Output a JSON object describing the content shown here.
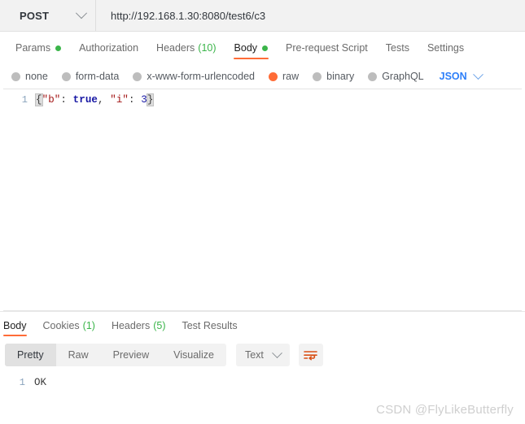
{
  "request": {
    "method": "POST",
    "method_icon": "chevron-down-icon",
    "url": "http://192.168.1.30:8080/test6/c3",
    "url_placeholder": "Enter request URL",
    "tabs": [
      {
        "label": "Params",
        "badge": "",
        "dot": true,
        "active": false
      },
      {
        "label": "Authorization",
        "badge": "",
        "dot": false,
        "active": false
      },
      {
        "label": "Headers",
        "badge": "(10)",
        "dot": false,
        "active": false
      },
      {
        "label": "Body",
        "badge": "",
        "dot": true,
        "active": true
      },
      {
        "label": "Pre-request Script",
        "badge": "",
        "dot": false,
        "active": false
      },
      {
        "label": "Tests",
        "badge": "",
        "dot": false,
        "active": false
      },
      {
        "label": "Settings",
        "badge": "",
        "dot": false,
        "active": false
      }
    ],
    "body_types": [
      {
        "label": "none",
        "selected": false
      },
      {
        "label": "form-data",
        "selected": false
      },
      {
        "label": "x-www-form-urlencoded",
        "selected": false
      },
      {
        "label": "raw",
        "selected": true
      },
      {
        "label": "binary",
        "selected": false
      },
      {
        "label": "GraphQL",
        "selected": false
      }
    ],
    "format_select": "JSON",
    "format_select_icon": "chevron-down-icon",
    "editor": {
      "line_number": "1",
      "raw": "{\"b\": true, \"i\": 3}",
      "tokens": {
        "open_brace": "{",
        "key_b": "\"b\"",
        "colon1": ": ",
        "value_true": "true",
        "comma": ", ",
        "key_i": "\"i\"",
        "colon2": ": ",
        "value_3": "3",
        "close_brace": "}"
      }
    }
  },
  "response": {
    "tabs": [
      {
        "label": "Body",
        "badge": "",
        "active": true
      },
      {
        "label": "Cookies",
        "badge": "(1)",
        "active": false
      },
      {
        "label": "Headers",
        "badge": "(5)",
        "active": false
      },
      {
        "label": "Test Results",
        "badge": "",
        "active": false
      }
    ],
    "view_modes": [
      {
        "label": "Pretty",
        "active": true
      },
      {
        "label": "Raw",
        "active": false
      },
      {
        "label": "Preview",
        "active": false
      },
      {
        "label": "Visualize",
        "active": false
      }
    ],
    "format_select": "Text",
    "format_select_icon": "chevron-down-icon",
    "wrap_button_icon": "word-wrap-icon",
    "body": {
      "line_number": "1",
      "text": "OK"
    }
  },
  "watermark": "CSDN @FlyLikeButterfly",
  "colors": {
    "accent": "#ff6c37",
    "dot_green": "#3bb54a",
    "link_blue": "#2d7ff9",
    "gutter_blue": "#8aa4bd"
  }
}
